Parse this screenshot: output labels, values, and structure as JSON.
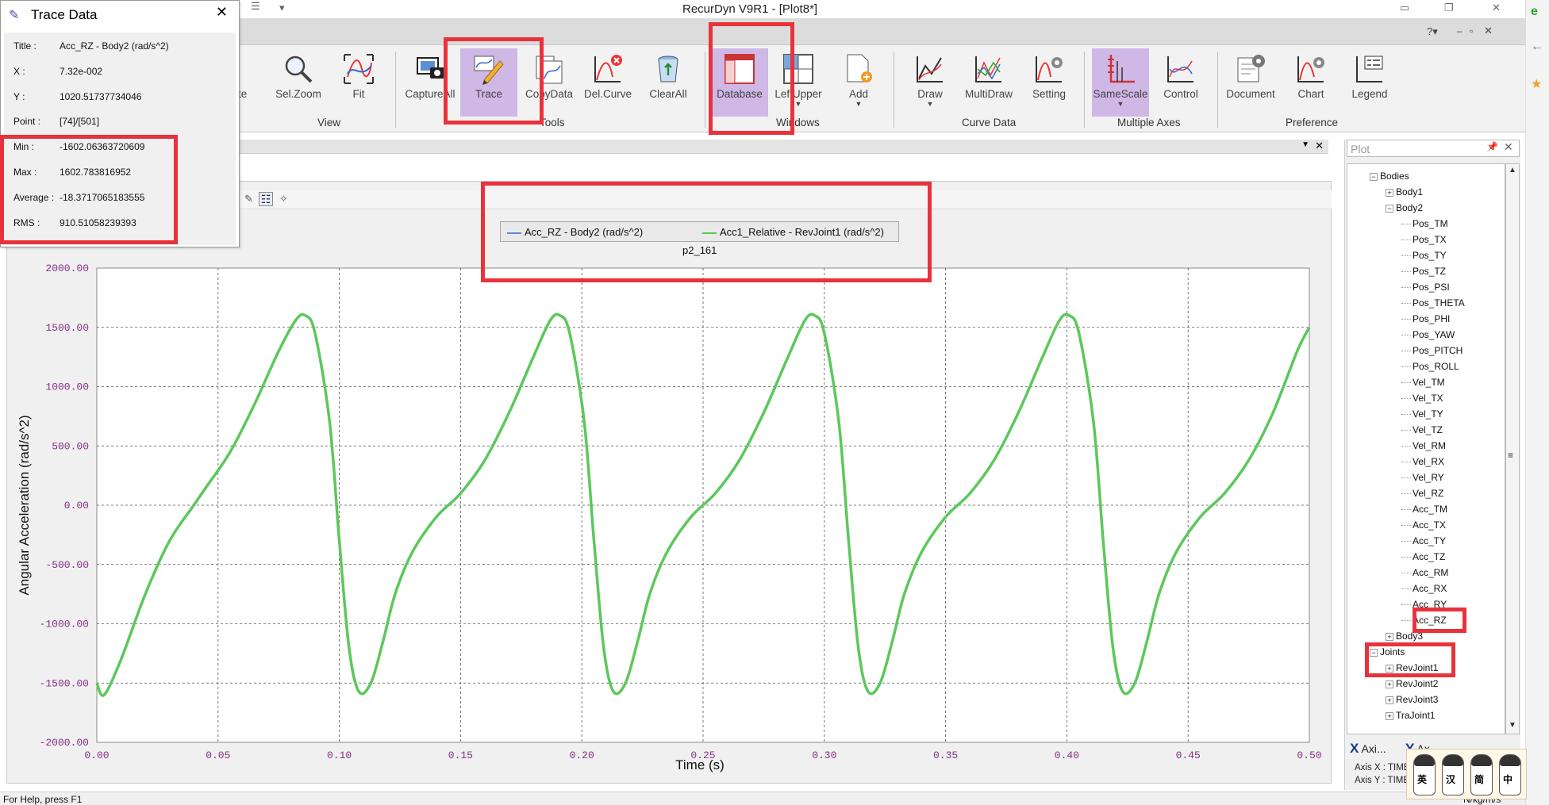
{
  "app": {
    "title": "RecurDyn V9R1  - [Plot8*]"
  },
  "ribbon": {
    "tools": [
      {
        "label": "Sel.Zoom",
        "icon": "magnifier-icon"
      },
      {
        "label": "Fit",
        "icon": "fit-curve-icon"
      },
      {
        "label": "CaptureAll",
        "icon": "camera-icon"
      },
      {
        "label": "Trace",
        "icon": "trace-pencil-icon"
      },
      {
        "label": "CopyData",
        "icon": "copy-data-icon"
      },
      {
        "label": "Del.Curve",
        "icon": "delete-curve-icon"
      },
      {
        "label": "ClearAll",
        "icon": "recycle-bin-icon"
      },
      {
        "label": "Database",
        "icon": "database-window-icon"
      },
      {
        "label": "LeftUpper",
        "icon": "left-upper-window-icon"
      },
      {
        "label": "Add",
        "icon": "add-page-icon"
      },
      {
        "label": "Draw",
        "icon": "draw-curve-icon"
      },
      {
        "label": "MultiDraw",
        "icon": "multi-draw-icon"
      },
      {
        "label": "Setting",
        "icon": "curve-setting-icon"
      },
      {
        "label": "SameScale",
        "icon": "same-scale-axes-icon"
      },
      {
        "label": "Control",
        "icon": "axes-control-icon"
      },
      {
        "label": "Document",
        "icon": "document-settings-icon"
      },
      {
        "label": "Chart",
        "icon": "chart-settings-icon"
      },
      {
        "label": "Legend",
        "icon": "legend-icon"
      }
    ],
    "group_labels": {
      "view": "View",
      "tools": "Tools",
      "windows": "Windows",
      "curve_data": "Curve Data",
      "multiple_axes": "Multiple Axes",
      "preference": "Preference"
    },
    "partial_left_label": "te"
  },
  "trace": {
    "title": "Trace Data",
    "rows": [
      {
        "label": "Title :",
        "value": "Acc_RZ - Body2 (rad/s^2)"
      },
      {
        "label": "X :",
        "value": "7.32e-002"
      },
      {
        "label": "Y :",
        "value": "1020.51737734046"
      },
      {
        "label": "Point :",
        "value": "[74]/[501]"
      },
      {
        "label": "Min :",
        "value": "-1602.06363720609"
      },
      {
        "label": "Max :",
        "value": "1602.783816952"
      },
      {
        "label": "Average :",
        "value": "-18.3717065183555"
      },
      {
        "label": "RMS :",
        "value": "910.51058239393"
      }
    ]
  },
  "legend": {
    "items": [
      {
        "label": "Acc_RZ - Body2 (rad/s^2)",
        "color": "#6b7fd6"
      },
      {
        "label": "Acc1_Relative - RevJoint1 (rad/s^2)",
        "color": "#5cc85c"
      }
    ],
    "subtitle": "p2_161"
  },
  "chart_data": {
    "type": "line",
    "xlabel": "Time (s)",
    "ylabel": "Angular Acceleration (rad/s^2)",
    "xlim": [
      0,
      0.5
    ],
    "ylim": [
      -2000,
      2000
    ],
    "x_ticks": [
      "0.00",
      "0.05",
      "0.10",
      "0.15",
      "0.20",
      "0.25",
      "0.30",
      "0.35",
      "0.40",
      "0.45",
      "0.50"
    ],
    "y_ticks": [
      "2000.00",
      "1500.00",
      "1000.00",
      "500.00",
      "0.00",
      "-500.00",
      "-1000.00",
      "-1500.00",
      "-2000.00"
    ],
    "grid": true,
    "series": [
      {
        "name": "Acc1_Relative - RevJoint1 (rad/s^2)",
        "color": "#5cc85c",
        "x": [
          0.0,
          0.003,
          0.01,
          0.02,
          0.03,
          0.04,
          0.045,
          0.055,
          0.065,
          0.075,
          0.082,
          0.086,
          0.09,
          0.096,
          0.1,
          0.104,
          0.108,
          0.113,
          0.118,
          0.123,
          0.13,
          0.14,
          0.15,
          0.16,
          0.17,
          0.18,
          0.187,
          0.191,
          0.195,
          0.201,
          0.205,
          0.209,
          0.213,
          0.218,
          0.223,
          0.228,
          0.235,
          0.245,
          0.255,
          0.265,
          0.275,
          0.285,
          0.292,
          0.296,
          0.3,
          0.306,
          0.31,
          0.314,
          0.318,
          0.323,
          0.328,
          0.333,
          0.34,
          0.35,
          0.36,
          0.37,
          0.38,
          0.39,
          0.397,
          0.401,
          0.405,
          0.411,
          0.415,
          0.419,
          0.423,
          0.428,
          0.433,
          0.438,
          0.445,
          0.455,
          0.465,
          0.475,
          0.485,
          0.495,
          0.5
        ],
        "y": [
          -1500,
          -1600,
          -1300,
          -750,
          -300,
          0,
          150,
          450,
          850,
          1300,
          1560,
          1600,
          1450,
          700,
          -300,
          -1200,
          -1570,
          -1500,
          -1150,
          -750,
          -400,
          -100,
          100,
          380,
          780,
          1250,
          1560,
          1600,
          1450,
          700,
          -300,
          -1200,
          -1570,
          -1500,
          -1150,
          -750,
          -400,
          -100,
          100,
          380,
          780,
          1250,
          1560,
          1600,
          1450,
          700,
          -300,
          -1200,
          -1570,
          -1500,
          -1150,
          -750,
          -400,
          -100,
          100,
          380,
          780,
          1250,
          1560,
          1600,
          1450,
          700,
          -300,
          -1200,
          -1570,
          -1500,
          -1150,
          -750,
          -400,
          -100,
          100,
          380,
          780,
          1300,
          1500
        ]
      }
    ]
  },
  "tree": {
    "search_placeholder": "Plot",
    "nodes": [
      {
        "label": "Bodies",
        "depth": 0,
        "expander": "−"
      },
      {
        "label": "Body1",
        "depth": 1,
        "expander": "+"
      },
      {
        "label": "Body2",
        "depth": 1,
        "expander": "−"
      },
      {
        "label": "Pos_TM",
        "depth": 2,
        "expander": ""
      },
      {
        "label": "Pos_TX",
        "depth": 2,
        "expander": ""
      },
      {
        "label": "Pos_TY",
        "depth": 2,
        "expander": ""
      },
      {
        "label": "Pos_TZ",
        "depth": 2,
        "expander": ""
      },
      {
        "label": "Pos_PSI",
        "depth": 2,
        "expander": ""
      },
      {
        "label": "Pos_THETA",
        "depth": 2,
        "expander": ""
      },
      {
        "label": "Pos_PHI",
        "depth": 2,
        "expander": ""
      },
      {
        "label": "Pos_YAW",
        "depth": 2,
        "expander": ""
      },
      {
        "label": "Pos_PITCH",
        "depth": 2,
        "expander": ""
      },
      {
        "label": "Pos_ROLL",
        "depth": 2,
        "expander": ""
      },
      {
        "label": "Vel_TM",
        "depth": 2,
        "expander": ""
      },
      {
        "label": "Vel_TX",
        "depth": 2,
        "expander": ""
      },
      {
        "label": "Vel_TY",
        "depth": 2,
        "expander": ""
      },
      {
        "label": "Vel_TZ",
        "depth": 2,
        "expander": ""
      },
      {
        "label": "Vel_RM",
        "depth": 2,
        "expander": ""
      },
      {
        "label": "Vel_RX",
        "depth": 2,
        "expander": ""
      },
      {
        "label": "Vel_RY",
        "depth": 2,
        "expander": ""
      },
      {
        "label": "Vel_RZ",
        "depth": 2,
        "expander": ""
      },
      {
        "label": "Acc_TM",
        "depth": 2,
        "expander": ""
      },
      {
        "label": "Acc_TX",
        "depth": 2,
        "expander": ""
      },
      {
        "label": "Acc_TY",
        "depth": 2,
        "expander": ""
      },
      {
        "label": "Acc_TZ",
        "depth": 2,
        "expander": ""
      },
      {
        "label": "Acc_RM",
        "depth": 2,
        "expander": ""
      },
      {
        "label": "Acc_RX",
        "depth": 2,
        "expander": ""
      },
      {
        "label": "Acc_RY",
        "depth": 2,
        "expander": ""
      },
      {
        "label": "Acc_RZ",
        "depth": 2,
        "expander": ""
      },
      {
        "label": "Body3",
        "depth": 1,
        "expander": "+"
      },
      {
        "label": "Joints",
        "depth": 0,
        "expander": "−"
      },
      {
        "label": "RevJoint1",
        "depth": 1,
        "expander": "+"
      },
      {
        "label": "RevJoint2",
        "depth": 1,
        "expander": "+"
      },
      {
        "label": "RevJoint3",
        "depth": 1,
        "expander": "+"
      },
      {
        "label": "TraJoint1",
        "depth": 1,
        "expander": "+"
      }
    ],
    "axis_tabs": [
      {
        "label": "Axi...",
        "icon": "x-axis-icon"
      },
      {
        "label": "Ax...",
        "icon": "y-axis-icon"
      }
    ],
    "axis_info": [
      "Axis X : TIME",
      "Axis Y : TIME"
    ]
  },
  "status": {
    "text": "For Help, press F1",
    "units": "N/kg/m/s"
  },
  "sticker": {
    "chars": [
      "英",
      "汉",
      "简",
      "中"
    ]
  },
  "colors": {
    "annotation_red": "#e8323c",
    "ribbon_selected": "#cfb7e6",
    "curve_green": "#5cc85c",
    "tick_purple": "#8a2f8a"
  }
}
